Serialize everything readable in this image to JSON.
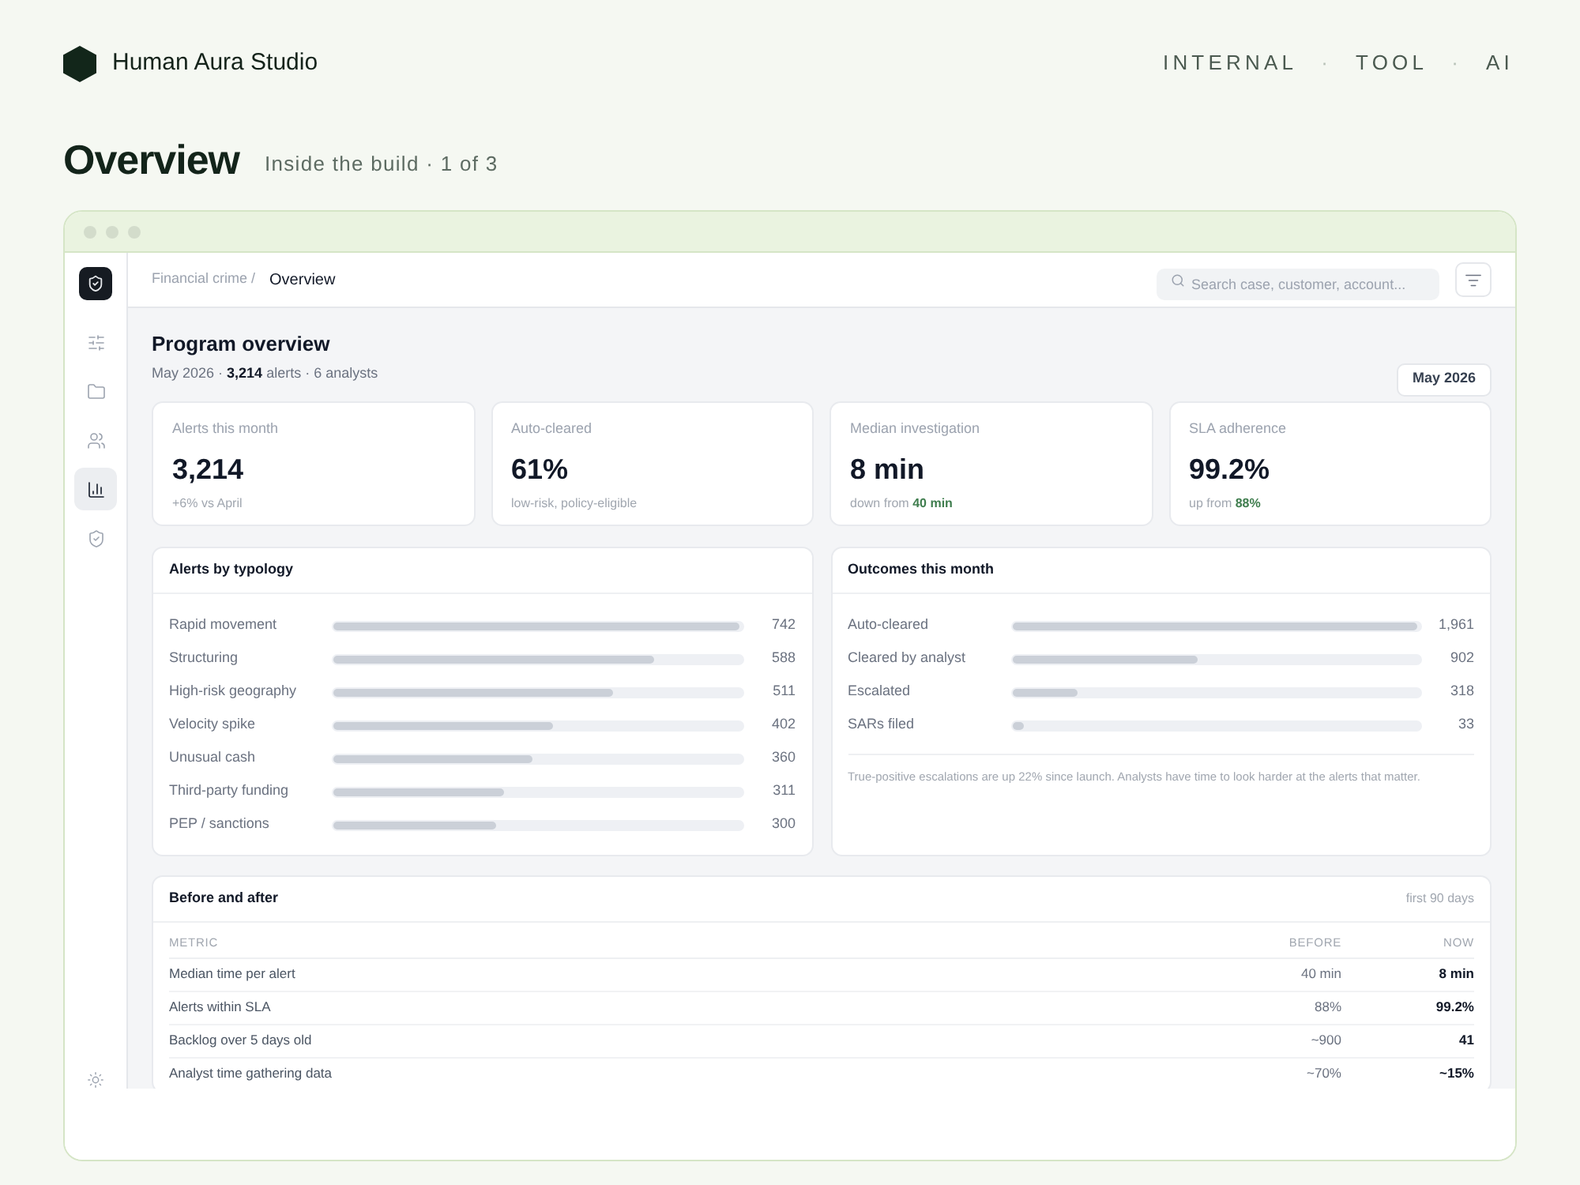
{
  "brand": {
    "name": "Human Aura Studio"
  },
  "tags": [
    "INTERNAL",
    "·",
    "TOOL",
    "·",
    "AI"
  ],
  "page": {
    "title": "Overview",
    "subtitle": "Inside the build · 1 of 3"
  },
  "app": {
    "sidebar": {
      "items": [
        {
          "selected": false
        },
        {
          "selected": false
        },
        {
          "selected": false
        },
        {
          "selected": true
        },
        {
          "selected": false
        }
      ]
    },
    "breadcrumb": {
      "parent": "Financial crime /",
      "current": "Overview"
    },
    "search": {
      "placeholder": "Search case, customer, account..."
    },
    "heading": {
      "title": "Program overview",
      "meta": "May 2026 · **3,214** alerts · 6 analysts"
    },
    "period_button": "May 2026",
    "kpis": [
      {
        "label": "Alerts this month",
        "value": "3,214",
        "note": "+6% vs April"
      },
      {
        "label": "Auto-cleared",
        "value": "61%",
        "note": "low-risk, policy-eligible"
      },
      {
        "label": "Median investigation",
        "value": "8 min",
        "note": "down from **40 min**"
      },
      {
        "label": "SLA adherence",
        "value": "99.2%",
        "note": "up from **88%**"
      }
    ],
    "typology": {
      "title": "Alerts by typology",
      "rows": [
        {
          "label": "Rapid movement",
          "level": 1,
          "value": "742"
        },
        {
          "label": "Structuring",
          "level": 0.79,
          "value": "588"
        },
        {
          "label": "High-risk geography",
          "level": 0.69,
          "value": "511"
        },
        {
          "label": "Velocity spike",
          "level": 0.54,
          "value": "402"
        },
        {
          "label": "Unusual cash",
          "level": 0.49,
          "value": "360"
        },
        {
          "label": "Third-party funding",
          "level": 0.42,
          "value": "311"
        },
        {
          "label": "PEP / sanctions",
          "level": 0.4,
          "value": "300"
        }
      ]
    },
    "outcomes": {
      "title": "Outcomes this month",
      "rows": [
        {
          "label": "Auto-cleared",
          "level": 1,
          "value": "1,961"
        },
        {
          "label": "Cleared by analyst",
          "level": 0.46,
          "value": "902"
        },
        {
          "label": "Escalated",
          "level": 0.16,
          "value": "318"
        },
        {
          "label": "SARs filed",
          "level": 0.03,
          "value": "33"
        }
      ],
      "note": "True-positive escalations are up 22% since launch. Analysts have time to look harder at the alerts that matter."
    },
    "comparison": {
      "title": "Before and after",
      "range": "first 90 days",
      "columns": [
        "METRIC",
        "BEFORE",
        "NOW"
      ],
      "rows": [
        [
          "Median time per alert",
          "40 min",
          "8 min"
        ],
        [
          "Alerts within SLA",
          "88%",
          "99.2%"
        ],
        [
          "Backlog over 5 days old",
          "~900",
          "41"
        ],
        [
          "Analyst time gathering data",
          "~70%",
          "~15%"
        ]
      ]
    }
  }
}
